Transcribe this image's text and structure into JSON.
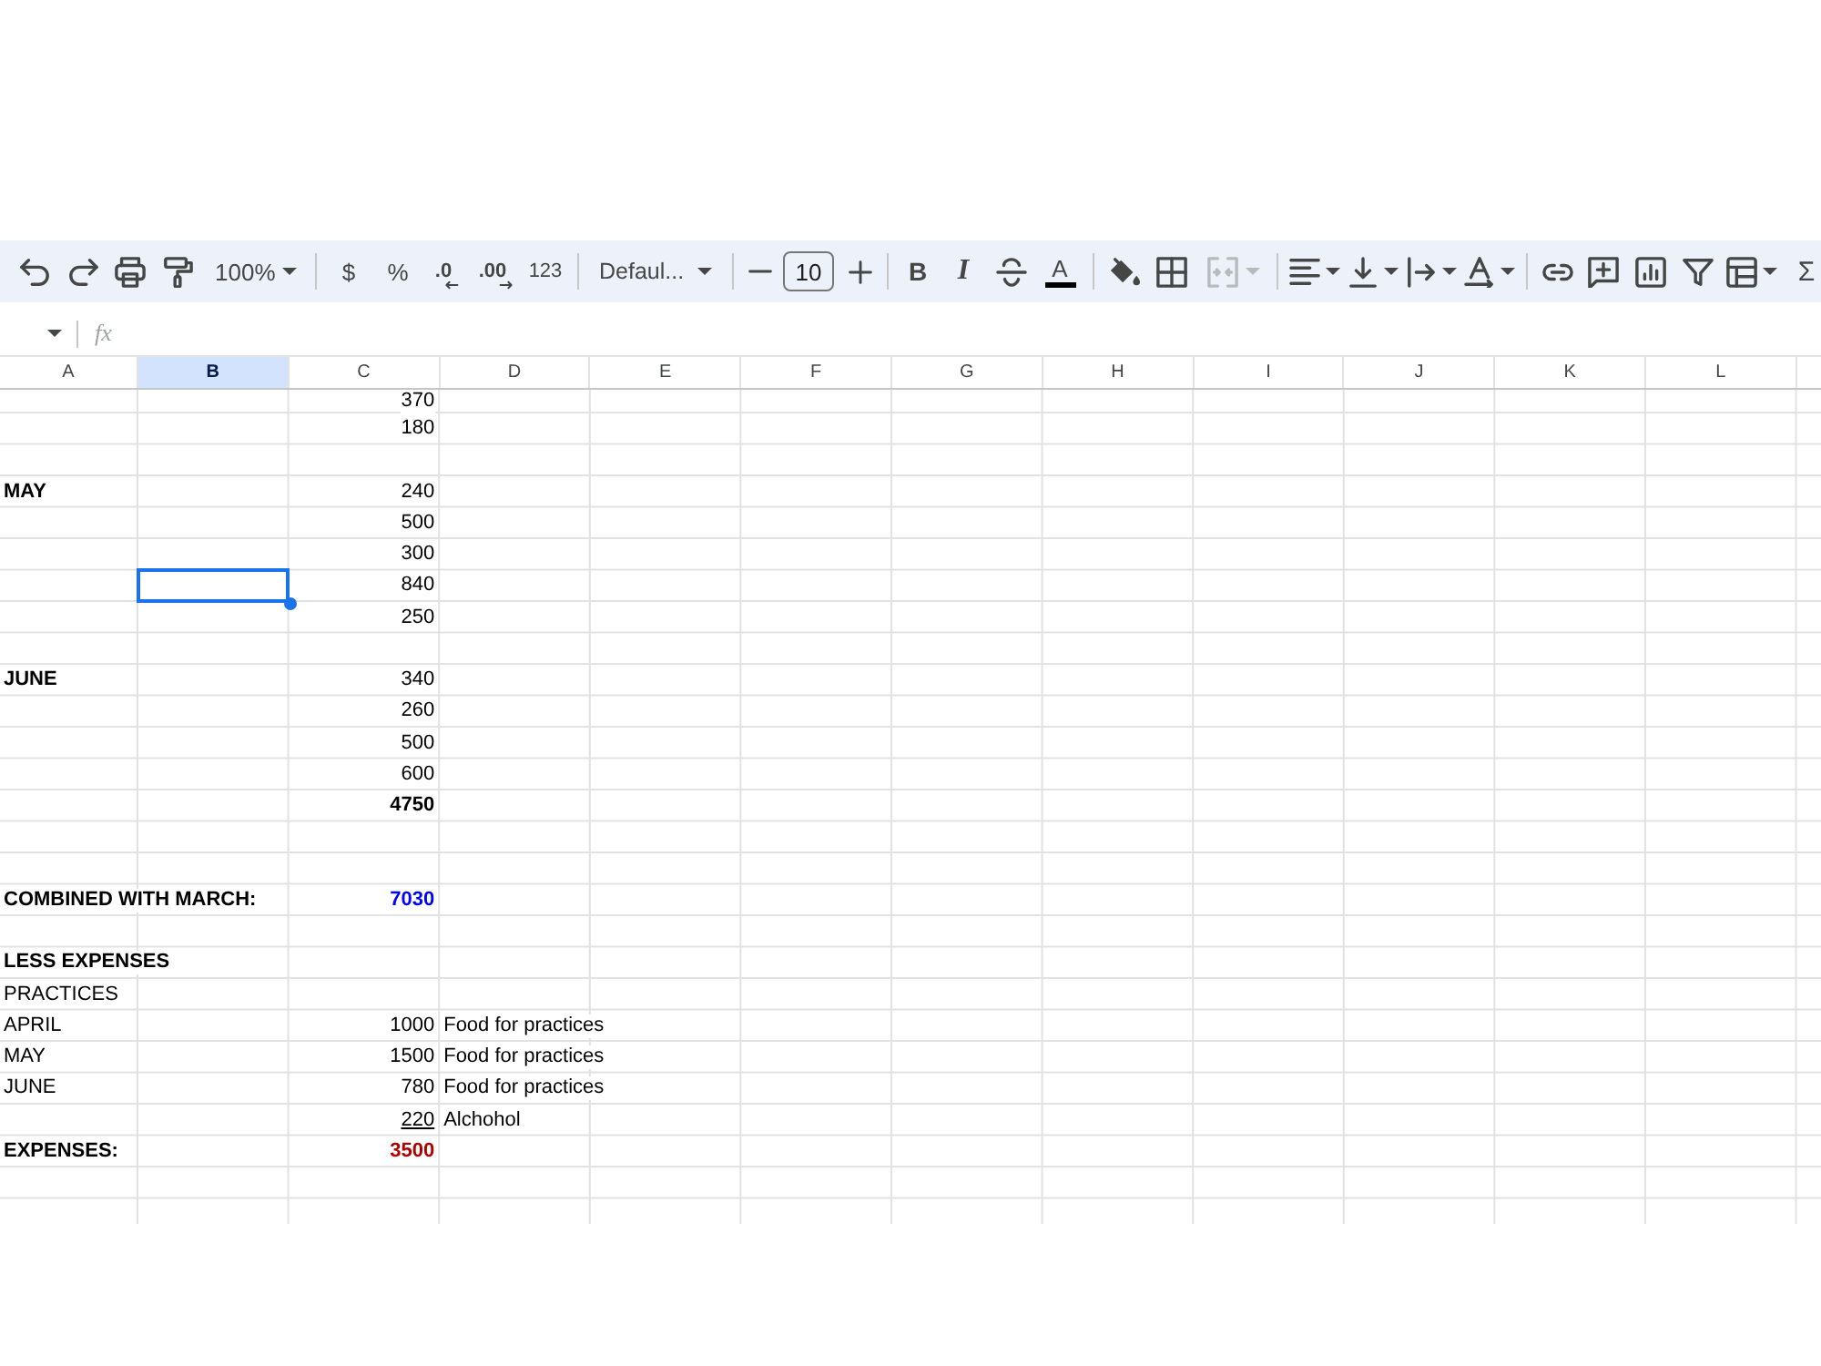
{
  "toolbar": {
    "items": [
      {
        "kind": "undo",
        "dropdown": false,
        "disabled": false
      },
      {
        "kind": "redo",
        "dropdown": false,
        "disabled": false
      },
      {
        "kind": "print",
        "dropdown": false,
        "disabled": false
      },
      {
        "kind": "paint-format",
        "dropdown": false,
        "disabled": false
      },
      {
        "kind": "zoom",
        "label": "100%",
        "dropdown": true,
        "disabled": false
      },
      {
        "kind": "separator"
      },
      {
        "kind": "currency",
        "label": "$",
        "dropdown": false,
        "disabled": false
      },
      {
        "kind": "percent",
        "label": "%",
        "dropdown": false,
        "disabled": false
      },
      {
        "kind": "decrease-decimal",
        "label": ".0",
        "dropdown": false,
        "disabled": false
      },
      {
        "kind": "increase-decimal",
        "label": ".00",
        "dropdown": false,
        "disabled": false
      },
      {
        "kind": "number-format",
        "label": "123",
        "dropdown": false,
        "disabled": false
      },
      {
        "kind": "separator"
      },
      {
        "kind": "font",
        "label": "Defaul...",
        "dropdown": true,
        "disabled": false
      },
      {
        "kind": "separator"
      },
      {
        "kind": "font-size-down",
        "dropdown": false,
        "disabled": false
      },
      {
        "kind": "font-size",
        "value": "10"
      },
      {
        "kind": "font-size-up",
        "dropdown": false,
        "disabled": false
      },
      {
        "kind": "separator"
      },
      {
        "kind": "bold",
        "label": "B",
        "dropdown": false,
        "disabled": false
      },
      {
        "kind": "italic",
        "label": "I",
        "dropdown": false,
        "disabled": false
      },
      {
        "kind": "strikethrough",
        "dropdown": false,
        "disabled": false
      },
      {
        "kind": "text-color",
        "label": "A",
        "dropdown": false,
        "disabled": false
      },
      {
        "kind": "separator"
      },
      {
        "kind": "fill-color",
        "dropdown": false,
        "disabled": false
      },
      {
        "kind": "borders",
        "dropdown": false,
        "disabled": false
      },
      {
        "kind": "merge",
        "dropdown": true,
        "disabled": true
      },
      {
        "kind": "separator"
      },
      {
        "kind": "align",
        "dropdown": true,
        "disabled": false
      },
      {
        "kind": "valign",
        "dropdown": true,
        "disabled": false
      },
      {
        "kind": "wrap",
        "dropdown": true,
        "disabled": false
      },
      {
        "kind": "rotate",
        "dropdown": true,
        "disabled": false
      },
      {
        "kind": "separator"
      },
      {
        "kind": "link",
        "dropdown": false,
        "disabled": false
      },
      {
        "kind": "comment",
        "dropdown": false,
        "disabled": false
      },
      {
        "kind": "chart",
        "dropdown": false,
        "disabled": false
      },
      {
        "kind": "filter",
        "dropdown": false,
        "disabled": false
      },
      {
        "kind": "table",
        "dropdown": true,
        "disabled": false
      },
      {
        "kind": "functions",
        "label": "Σ",
        "dropdown": false,
        "disabled": false
      }
    ]
  },
  "formula_bar": {
    "name_box": {
      "dropdown": true
    },
    "function_label": "fx"
  },
  "sheet": {
    "columns": [
      {
        "label": "A",
        "selected": false
      },
      {
        "label": "B",
        "selected": true
      },
      {
        "label": "C",
        "selected": false
      },
      {
        "label": "D",
        "selected": false
      },
      {
        "label": "E",
        "selected": false
      },
      {
        "label": "F",
        "selected": false
      },
      {
        "label": "G",
        "selected": false
      },
      {
        "label": "H",
        "selected": false
      },
      {
        "label": "I",
        "selected": false
      },
      {
        "label": "J",
        "selected": false
      },
      {
        "label": "K",
        "selected": false
      },
      {
        "label": "L",
        "selected": false
      }
    ],
    "rows": [
      {
        "c": {
          "kind": "number",
          "text": "370",
          "bold": false,
          "underline": false,
          "selected": false
        }
      },
      {
        "c": {
          "kind": "number",
          "text": "180",
          "bold": false,
          "underline": false,
          "selected": false
        }
      },
      {},
      {
        "a": {
          "kind": "text",
          "text": "MAY",
          "bold": true,
          "underline": false,
          "selected": false
        },
        "c": {
          "kind": "number",
          "text": "240",
          "bold": false,
          "underline": false,
          "selected": false
        }
      },
      {
        "c": {
          "kind": "number",
          "text": "500",
          "bold": false,
          "underline": false,
          "selected": false
        }
      },
      {
        "c": {
          "kind": "number",
          "text": "300",
          "bold": false,
          "underline": false,
          "selected": false
        }
      },
      {
        "b": {
          "selected": true
        },
        "c": {
          "kind": "number",
          "text": "840",
          "bold": false,
          "underline": false,
          "selected": false
        }
      },
      {
        "c": {
          "kind": "number",
          "text": "250",
          "bold": false,
          "underline": false,
          "selected": false
        }
      },
      {},
      {
        "a": {
          "kind": "text",
          "text": "JUNE",
          "bold": true,
          "underline": false,
          "selected": false
        },
        "c": {
          "kind": "number",
          "text": "340",
          "bold": false,
          "underline": false,
          "selected": false
        }
      },
      {
        "c": {
          "kind": "number",
          "text": "260",
          "bold": false,
          "underline": false,
          "selected": false
        }
      },
      {
        "c": {
          "kind": "number",
          "text": "500",
          "bold": false,
          "underline": false,
          "selected": false
        }
      },
      {
        "c": {
          "kind": "number",
          "text": "600",
          "bold": false,
          "underline": false,
          "selected": false
        }
      },
      {
        "c": {
          "kind": "number",
          "text": "4750",
          "bold": true,
          "underline": false,
          "selected": false
        }
      },
      {},
      {},
      {
        "a": {
          "kind": "text",
          "text": "COMBINED WITH MARCH:",
          "bold": true,
          "underline": false,
          "selected": false
        },
        "c": {
          "kind": "number",
          "text": "7030",
          "bold": true,
          "underline": false,
          "selected": false,
          "color": "#0000ff"
        }
      },
      {},
      {
        "a": {
          "kind": "text",
          "text": "LESS EXPENSES",
          "bold": true,
          "underline": false,
          "selected": false
        }
      },
      {
        "a": {
          "kind": "text",
          "text": "PRACTICES",
          "bold": false,
          "underline": false,
          "selected": false
        }
      },
      {
        "a": {
          "kind": "text",
          "text": "APRIL",
          "bold": false,
          "underline": false,
          "selected": false
        },
        "c": {
          "kind": "number",
          "text": "1000",
          "bold": false,
          "underline": false,
          "selected": false
        },
        "d": {
          "kind": "text",
          "text": "Food for practices",
          "bold": false,
          "underline": false,
          "selected": false
        }
      },
      {
        "a": {
          "kind": "text",
          "text": "MAY",
          "bold": false,
          "underline": false,
          "selected": false
        },
        "c": {
          "kind": "number",
          "text": "1500",
          "bold": false,
          "underline": false,
          "selected": false
        },
        "d": {
          "kind": "text",
          "text": "Food for practices",
          "bold": false,
          "underline": false,
          "selected": false
        }
      },
      {
        "a": {
          "kind": "text",
          "text": "JUNE",
          "bold": false,
          "underline": false,
          "selected": false
        },
        "c": {
          "kind": "number",
          "text": "780",
          "bold": false,
          "underline": false,
          "selected": false
        },
        "d": {
          "kind": "text",
          "text": "Food for practices",
          "bold": false,
          "underline": false,
          "selected": false
        }
      },
      {
        "c": {
          "kind": "number",
          "text": "220",
          "bold": false,
          "underline": true,
          "selected": false
        },
        "d": {
          "kind": "text",
          "text": "Alchohol",
          "bold": false,
          "underline": false,
          "selected": false
        }
      },
      {
        "a": {
          "kind": "text",
          "text": "EXPENSES:",
          "bold": true,
          "underline": false,
          "selected": false
        },
        "c": {
          "kind": "number",
          "text": "3500",
          "bold": true,
          "underline": false,
          "selected": false,
          "color": "#b00000"
        }
      },
      {},
      {}
    ]
  }
}
